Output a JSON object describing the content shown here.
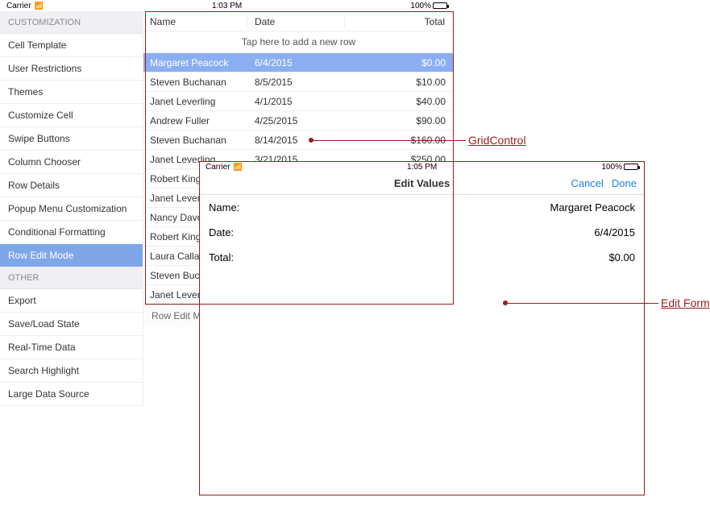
{
  "status_back": {
    "carrier": "Carrier",
    "wifi_glyph": "✶",
    "time": "1:03 PM",
    "battery_pct": "100%"
  },
  "status_front": {
    "carrier": "Carrier",
    "wifi_glyph": "✶",
    "time": "1:05 PM",
    "battery_pct": "100%"
  },
  "sidebar": {
    "sections": [
      {
        "header": "CUSTOMIZATION",
        "items": [
          {
            "label": "Cell Template",
            "selected": false
          },
          {
            "label": "User Restrictions",
            "selected": false
          },
          {
            "label": "Themes",
            "selected": false
          },
          {
            "label": "Customize Cell",
            "selected": false
          },
          {
            "label": "Swipe Buttons",
            "selected": false
          },
          {
            "label": "Column Chooser",
            "selected": false
          },
          {
            "label": "Row Details",
            "selected": false
          },
          {
            "label": "Popup Menu Customization",
            "selected": false
          },
          {
            "label": "Conditional Formatting",
            "selected": false
          },
          {
            "label": "Row Edit Mode",
            "selected": true
          }
        ]
      },
      {
        "header": "OTHER",
        "items": [
          {
            "label": "Export",
            "selected": false
          },
          {
            "label": "Save/Load State",
            "selected": false
          },
          {
            "label": "Real-Time Data",
            "selected": false
          },
          {
            "label": "Search Highlight",
            "selected": false
          },
          {
            "label": "Large Data Source",
            "selected": false
          }
        ]
      }
    ]
  },
  "grid": {
    "columns": {
      "name": "Name",
      "date": "Date",
      "total": "Total"
    },
    "new_row_hint": "Tap here to add a new row",
    "rows": [
      {
        "name": "Margaret Peacock",
        "date": "6/4/2015",
        "total": "$0.00",
        "selected": true
      },
      {
        "name": "Steven Buchanan",
        "date": "8/5/2015",
        "total": "$10.00",
        "selected": false
      },
      {
        "name": "Janet Leverling",
        "date": "4/1/2015",
        "total": "$40.00",
        "selected": false
      },
      {
        "name": "Andrew Fuller",
        "date": "4/25/2015",
        "total": "$90.00",
        "selected": false
      },
      {
        "name": "Steven Buchanan",
        "date": "8/14/2015",
        "total": "$160.00",
        "selected": false
      },
      {
        "name": "Janet Leverling",
        "date": "3/21/2015",
        "total": "$250.00",
        "selected": false
      },
      {
        "name": "Robert King",
        "date": "",
        "total": "",
        "selected": false
      },
      {
        "name": "Janet Leverling",
        "date": "",
        "total": "",
        "selected": false
      },
      {
        "name": "Nancy Davolio",
        "date": "",
        "total": "",
        "selected": false
      },
      {
        "name": "Robert King",
        "date": "",
        "total": "",
        "selected": false
      },
      {
        "name": "Laura Callahan",
        "date": "",
        "total": "",
        "selected": false
      },
      {
        "name": "Steven Buchanan",
        "date": "",
        "total": "",
        "selected": false
      },
      {
        "name": "Janet Leverling",
        "date": "",
        "total": "",
        "selected": false
      }
    ],
    "bottom_label": "Row Edit Mode"
  },
  "edit_form": {
    "title": "Edit Values",
    "actions": {
      "cancel": "Cancel",
      "done": "Done"
    },
    "fields": [
      {
        "label": "Name:",
        "value": "Margaret Peacock"
      },
      {
        "label": "Date:",
        "value": "6/4/2015"
      },
      {
        "label": "Total:",
        "value": "$0.00"
      }
    ]
  },
  "annotations": {
    "grid": "GridControl",
    "form": "Edit Form"
  }
}
